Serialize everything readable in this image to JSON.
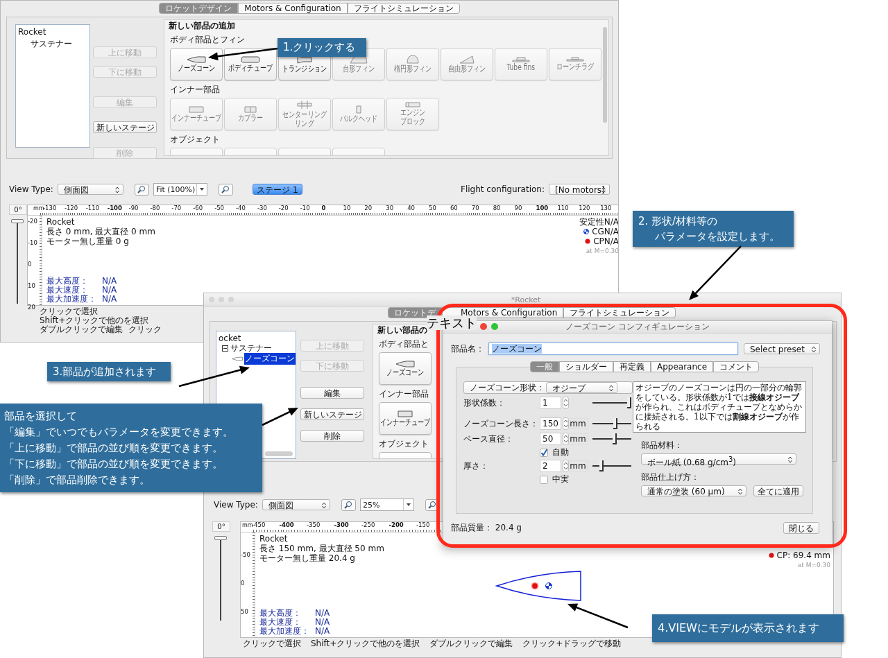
{
  "windows": [
    {
      "tabs": [
        {
          "label": "ロケットデザイン",
          "selected": true
        },
        {
          "label": "Motors & Configuration",
          "selected": false
        },
        {
          "label": "フライトシミュレーション",
          "selected": false
        }
      ],
      "tree": [
        {
          "label": "Rocket",
          "selected": false,
          "children": [
            {
              "label": "サステナー",
              "selected": false
            }
          ]
        }
      ],
      "buttons": [
        {
          "label": "上に移動",
          "disabled": true
        },
        {
          "label": "下に移動",
          "disabled": true
        },
        {
          "label": "編集",
          "disabled": true
        },
        {
          "label": "新しいステージ",
          "disabled": false
        },
        {
          "label": "削除",
          "disabled": true
        }
      ],
      "parts": {
        "title": "新しい部品の追加",
        "groups": [
          {
            "title": "ボディ部品とフィン",
            "items": [
              {
                "lines": [
                  "ノーズコーン"
                ],
                "kind": "nose",
                "disabled": false
              },
              {
                "lines": [
                  "ボディチューブ"
                ],
                "kind": "body",
                "disabled": false
              },
              {
                "lines": [
                  "トランジション"
                ],
                "kind": "transition",
                "disabled": false
              },
              {
                "lines": [
                  "台形フィン"
                ],
                "kind": "trapfin",
                "disabled": true
              },
              {
                "lines": [
                  "楕円形フィン"
                ],
                "kind": "ellfin",
                "disabled": true
              },
              {
                "lines": [
                  "自由形フィン"
                ],
                "kind": "freefin",
                "disabled": true
              },
              {
                "lines": [
                  "Tube fins"
                ],
                "kind": "tubefin",
                "disabled": true
              },
              {
                "lines": [
                  "ローンチラグ"
                ],
                "kind": "lug",
                "disabled": true
              }
            ]
          },
          {
            "title": "インナー部品",
            "items": [
              {
                "lines": [
                  "インナーチューブ"
                ],
                "kind": "innertube",
                "disabled": true
              },
              {
                "lines": [
                  "カプラー"
                ],
                "kind": "coupler",
                "disabled": true
              },
              {
                "lines": [
                  "センターリング",
                  "リング"
                ],
                "kind": "ring",
                "disabled": true
              },
              {
                "lines": [
                  "バルクヘッド"
                ],
                "kind": "bulkhead",
                "disabled": true
              },
              {
                "lines": [
                  "エンジン",
                  "ブロック"
                ],
                "kind": "engine",
                "disabled": true
              }
            ]
          },
          {
            "title": "オブジェクト",
            "items": [
              {
                "disabled": true
              },
              {
                "disabled": true
              },
              {
                "disabled": true
              },
              {
                "disabled": true
              }
            ]
          }
        ]
      },
      "toolbar": {
        "view_type_label": "View Type:",
        "view_type": "側面図",
        "zoom": "Fit (100%)",
        "stage": {
          "label": "ステージ 1",
          "selected": true
        },
        "flight_config_label": "Flight configuration:",
        "flight_config": "[No motors]"
      },
      "view": {
        "rotation": {
          "label": "0°",
          "level": 1
        },
        "unit": "mm",
        "x_ticks": [
          {
            "label": "-130",
            "bold": false
          },
          {
            "label": "-120",
            "bold": false
          },
          {
            "label": "-110",
            "bold": false
          },
          {
            "label": "-100",
            "bold": true
          },
          {
            "label": "-90",
            "bold": false
          },
          {
            "label": "-80",
            "bold": false
          },
          {
            "label": "-70",
            "bold": false
          },
          {
            "label": "-60",
            "bold": false
          },
          {
            "label": "-50",
            "bold": false
          },
          {
            "label": "-40",
            "bold": false
          },
          {
            "label": "-30",
            "bold": false
          },
          {
            "label": "-20",
            "bold": false
          },
          {
            "label": "-10",
            "bold": false
          },
          {
            "label": "0",
            "bold": true
          },
          {
            "label": "10",
            "bold": false
          },
          {
            "label": "20",
            "bold": false
          },
          {
            "label": "30",
            "bold": false
          },
          {
            "label": "40",
            "bold": false
          },
          {
            "label": "50",
            "bold": false
          },
          {
            "label": "60",
            "bold": false
          },
          {
            "label": "70",
            "bold": false
          },
          {
            "label": "80",
            "bold": false
          },
          {
            "label": "90",
            "bold": false
          },
          {
            "label": "100",
            "bold": true
          },
          {
            "label": "110",
            "bold": false
          },
          {
            "label": "120",
            "bold": false
          },
          {
            "label": "130",
            "bold": false
          }
        ],
        "y_ticks": [
          "-20",
          "-10",
          "0",
          "10",
          "20"
        ],
        "info": [
          "Rocket",
          "長さ 0 mm, 最大直径 0 mm",
          "モーター無し重量 0 g"
        ],
        "stability": [
          {
            "kind": "stability",
            "text": "安定性N/A"
          },
          {
            "kind": "cg",
            "text": "CGN/A"
          },
          {
            "kind": "cp",
            "text": "CPN/A"
          },
          {
            "kind": "mach",
            "text": "at M=0.30"
          }
        ],
        "stats": [
          {
            "label": "最大高度：",
            "value": "N/A"
          },
          {
            "label": "最大速度：",
            "value": "N/A"
          },
          {
            "label": "最大加速度：",
            "value": "N/A"
          }
        ]
      },
      "status": [
        "クリックで選択",
        "Shift+クリックで他のを選択",
        "ダブルクリックで編集",
        "クリック"
      ]
    },
    {
      "title": "*Rocket",
      "tabs": [
        {
          "label": "ロケットデ",
          "selected": true
        },
        {
          "label": "Motors & Configuration",
          "selected": false
        },
        {
          "label": "フライトシミュレーション",
          "selected": false
        }
      ],
      "tree": [
        {
          "label": "ocket",
          "selected": false,
          "children": [
            {
              "label": "サステナー",
              "selected": false,
              "expanded": true,
              "children": [
                {
                  "label": "ノーズコーン",
                  "kind": "nose",
                  "selected": true
                }
              ]
            }
          ]
        }
      ],
      "buttons": [
        {
          "label": "上に移動",
          "disabled": true
        },
        {
          "label": "下に移動",
          "disabled": true
        },
        {
          "label": "編集",
          "disabled": false
        },
        {
          "label": "新しいステージ",
          "disabled": false
        },
        {
          "label": "削除",
          "disabled": false
        }
      ],
      "parts": {
        "title": "新しい部品の",
        "groups": [
          {
            "title": "ボディ部品と",
            "items": [
              {
                "lines": [
                  "ノーズコーン"
                ],
                "kind": "nose",
                "disabled": false
              }
            ]
          },
          {
            "title": "インナー部品",
            "items": [
              {
                "lines": [
                  "インナーチューブ"
                ],
                "kind": "innertube",
                "disabled": false
              }
            ]
          },
          {
            "title": "オブジェクト",
            "items": [
              {
                "disabled": false
              }
            ]
          }
        ]
      },
      "toolbar": {
        "view_type_label": "View Type:",
        "view_type": "側面図",
        "zoom": "25%"
      },
      "view": {
        "rotation": {
          "label": "0°",
          "level": 1
        },
        "unit": "mm",
        "x_ticks": [
          {
            "label": "-450",
            "bold": false
          },
          {
            "label": "-400",
            "bold": true
          },
          {
            "label": "-350",
            "bold": false
          },
          {
            "label": "-300",
            "bold": true
          },
          {
            "label": "-250",
            "bold": false
          },
          {
            "label": "-200",
            "bold": true
          },
          {
            "label": "-150",
            "bold": false
          }
        ],
        "y_ticks": [
          "-50",
          "0",
          "50"
        ],
        "info": [
          "Rocket",
          "長さ 150 mm, 最大直径 50 mm",
          "モーター無し重量 20.4 g"
        ],
        "stability": [
          {
            "kind": "cp",
            "text": "CP: 69.4 mm"
          },
          {
            "kind": "mach",
            "text": "at M=0.30"
          }
        ],
        "stats": [
          {
            "label": "最大高度：",
            "value": "N/A"
          },
          {
            "label": "最大速度：",
            "value": "N/A"
          },
          {
            "label": "最大加速度：",
            "value": "N/A"
          }
        ],
        "model": {
          "kind": "nosecone"
        }
      },
      "status": [
        "クリックで選択",
        "Shift+クリックで他のを選択",
        "ダブルクリックで編集",
        "クリック+ドラッグで移動"
      ]
    }
  ],
  "overlay_label": "テキスト",
  "dialog": {
    "title": "ノーズコーン コンフィギュレーション",
    "name_label": "部品名：",
    "name_field": {
      "value": "ノーズコーン",
      "text_selected": true
    },
    "preset": "Select preset",
    "tabs": [
      {
        "label": "一般",
        "selected": true
      },
      {
        "label": "ショルダー",
        "selected": false
      },
      {
        "label": "再定義",
        "selected": false
      },
      {
        "label": "Appearance",
        "selected": false
      },
      {
        "label": "コメント",
        "selected": false
      }
    ],
    "rows": [
      {
        "kind": "select",
        "label": "ノーズコーン形状：",
        "value": "オジーブ"
      },
      {
        "kind": "number",
        "label": "形状係数：",
        "value": "1",
        "level": 1
      },
      {
        "kind": "number",
        "label": "ノーズコーン長さ：",
        "value": "150",
        "unit": "mm",
        "level": 0.6
      },
      {
        "kind": "number",
        "label": "ベース直径：",
        "value": "50",
        "unit": "mm",
        "level": 0.57
      },
      {
        "kind": "checkbox",
        "label": "自動",
        "checked": true
      },
      {
        "kind": "number",
        "label": "厚さ：",
        "value": "2",
        "unit": "mm",
        "level": 0.2
      },
      {
        "kind": "checkbox",
        "label": "中実",
        "checked": false
      }
    ],
    "description": "オジーブのノーズコーンは円の一部分の輪郭をしている。形状係数が1では**接線オジーブ**が作られ、これはボディチューブとなめらかに接続される。1以下では**割線オジーブ**が作られる",
    "material_label": "部品材料：",
    "material": "ボール紙 (0.68 g/cm$^{3}$)",
    "finish_label": "部品仕上げ方：",
    "finish": "通常の塗装 (60 μm)",
    "apply_all": "全てに適用",
    "mass": "部品質量： 20.4 g",
    "close": "閉じる"
  },
  "callouts": [
    {
      "lines": [
        "1.クリックする"
      ]
    },
    {
      "lines": [
        "2. 形状/材料等の",
        "パラメータを設定します。"
      ]
    },
    {
      "lines": [
        "3.部品が追加されます"
      ]
    },
    {
      "lines": [
        "部品を選択して",
        "「編集」でいつでもパラメータを変更できます。",
        "「上に移動」で部品の並び順を変更できます。",
        "「下に移動」で部品の並び順を変更できます。",
        "「削除」で部品削除できます。"
      ]
    },
    {
      "lines": [
        "4.VIEWにモデルが表示されます"
      ]
    }
  ]
}
